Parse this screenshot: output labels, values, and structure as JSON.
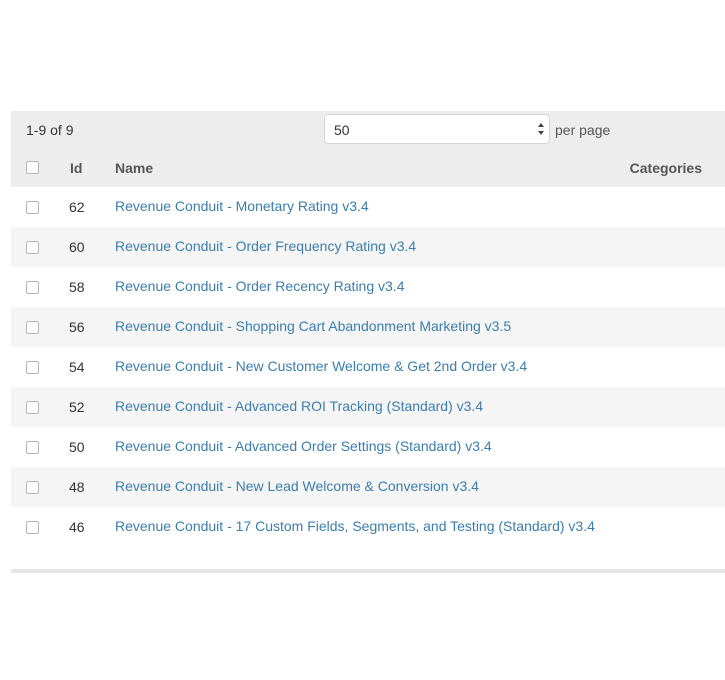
{
  "toolbar": {
    "count_label": "1-9 of 9",
    "per_page_value": "50",
    "per_page_label": "per page"
  },
  "table": {
    "columns": [
      "Id",
      "Name",
      "Categories"
    ],
    "rows": [
      {
        "id": "62",
        "name": "Revenue Conduit - Monetary Rating v3.4"
      },
      {
        "id": "60",
        "name": "Revenue Conduit - Order Frequency Rating v3.4"
      },
      {
        "id": "58",
        "name": "Revenue Conduit - Order Recency Rating v3.4"
      },
      {
        "id": "56",
        "name": "Revenue Conduit - Shopping Cart Abandonment Marketing v3.5"
      },
      {
        "id": "54",
        "name": "Revenue Conduit - New Customer Welcome & Get 2nd Order v3.4"
      },
      {
        "id": "52",
        "name": "Revenue Conduit - Advanced ROI Tracking (Standard) v3.4"
      },
      {
        "id": "50",
        "name": "Revenue Conduit - Advanced Order Settings (Standard) v3.4"
      },
      {
        "id": "48",
        "name": "Revenue Conduit - New Lead Welcome & Conversion v3.4"
      },
      {
        "id": "46",
        "name": "Revenue Conduit - 17 Custom Fields, Segments, and Testing (Standard) v3.4"
      }
    ]
  },
  "colors": {
    "link": "#3b7dac",
    "header_bg": "#ededed",
    "alt_row_bg": "#f5f5f5"
  },
  "icons": {
    "select_arrows": "up-down-chevron-icon",
    "checkbox": "checkbox-icon"
  }
}
